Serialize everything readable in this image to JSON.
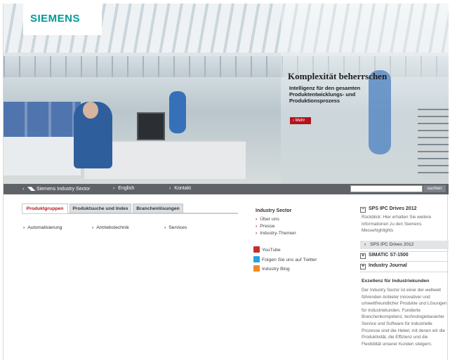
{
  "brand": {
    "logo": "SIEMENS",
    "accent": "#009999",
    "red": "#b5121b"
  },
  "hero": {
    "title": "Komplexität beherrschen",
    "subtitle": "Intelligenz für den gesamten Produktentwicklungs- und Produktionsprozess",
    "button": "Mehr"
  },
  "nav": {
    "items": [
      "Siemens Industry Sector",
      "English",
      "Kontakt"
    ],
    "search_placeholder": "",
    "search_button": "suchen"
  },
  "tabs": [
    "Produktgruppen",
    "Produktsuche und Index",
    "Branchenlösungen"
  ],
  "categories": [
    "Automatisierung",
    "Antriebstechnik",
    "Services"
  ],
  "industry": {
    "title": "Industry Sector",
    "links": [
      "Über uns",
      "Presse",
      "Industry-Themen"
    ],
    "social": [
      "YouTube",
      "Folgen Sie uns auf Twitter",
      "Industry Blog"
    ]
  },
  "sidebar": {
    "box1_title": "SPS IPC Drives 2012",
    "box1_text": "Rückblick: Hier erhalten Sie weitere Informationen zu den Siemens Messehighlights",
    "box1_link": "SPS IPC Drives 2012",
    "box2_title": "SIMATIC S7-1500",
    "box3_title": "Industry Journal",
    "section_title": "Exzellenz für Industriekunden",
    "section_text": "Der Industry Sector ist einer der weltweit führenden Anbieter innovativer und umweltfreundlicher Produkte und Lösungen für Industriekunden. Fundierte Branchenkompetenz, technologiebasierter Service und Software für industrielle Prozesse sind die Hebel, mit denen wir die Produktivität, die Effizienz und die Flexibilität unserer Kunden steigern."
  }
}
